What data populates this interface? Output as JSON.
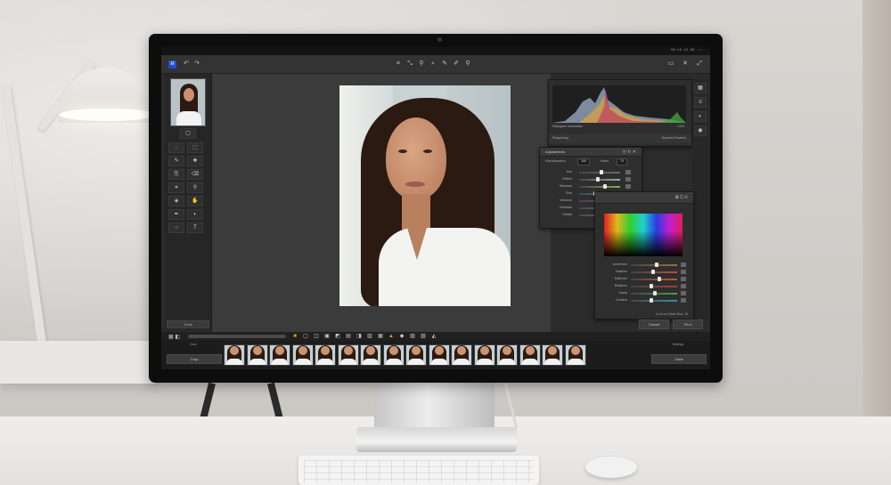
{
  "app": {
    "logo_text": "M",
    "menubar_status": "06:13  12 06  :::",
    "toolbar_icons": [
      "crop-icon",
      "transform-icon",
      "zoom-icon",
      "search-icon",
      "brush-icon",
      "eyedropper-icon",
      "loupe-icon"
    ],
    "toolbar_right_icons": [
      "compare-icon",
      "tools-icon",
      "expand-icon"
    ]
  },
  "left_panel": {
    "tools": [
      "lasso-icon",
      "marquee-icon",
      "brush-icon",
      "heal-icon",
      "clone-icon",
      "eraser-icon",
      "crop-icon",
      "zoom-icon",
      "paint-icon",
      "hand-icon",
      "pen-icon",
      "adjust-icon",
      "dodge-icon",
      "text-icon"
    ],
    "bottom_button": "Tools"
  },
  "histogram_panel": {
    "caption": "Histogram information",
    "footer_left": "Sharpening",
    "footer_right": "Brushes  Reselect",
    "value": "< 625"
  },
  "adjust_panel": {
    "title": "Adjustments",
    "field_label": "Hue/saturation",
    "field_value": "100",
    "field2_label": "Notes",
    "field2_value": "70",
    "rows": [
      {
        "label": "Hue",
        "level": 0.55,
        "color": "#6a6a6a"
      },
      {
        "label": "Whites",
        "level": 0.45,
        "color": "#a8a8a8"
      },
      {
        "label": "Shadows",
        "level": 0.62,
        "color": "#7fb04f"
      },
      {
        "label": "Tints",
        "level": 0.4,
        "color": "#46a0a0"
      },
      {
        "label": "Vibrance",
        "level": 0.58,
        "color": "#9a4fc0"
      },
      {
        "label": "Shadows",
        "level": 0.52,
        "color": "#4f7fd0"
      },
      {
        "label": "Details",
        "level": 0.42,
        "color": "#8a8a8a"
      }
    ]
  },
  "color_panel": {
    "rows": [
      {
        "label": "Undertone",
        "level": 0.55,
        "color": "#9a6f3d"
      },
      {
        "label": "Balance",
        "level": 0.48,
        "color": "#c04848"
      },
      {
        "label": "Midtones",
        "level": 0.62,
        "color": "#c05a30"
      },
      {
        "label": "Brilliance",
        "level": 0.45,
        "color": "#b03a3a"
      },
      {
        "label": "Clarity",
        "level": 0.52,
        "color": "#4aa04a"
      },
      {
        "label": "Shadow",
        "level": 0.44,
        "color": "#3a8fa0"
      }
    ],
    "footer": "Le ts el Colore  Duo: 10",
    "cancel_label": "Cancel",
    "ok_label": "Fix it"
  },
  "filmstrip": {
    "left_label": "Crop",
    "left_top_label": "Auto",
    "right_label": "Clear",
    "right_top_label": "Settings",
    "count": 16
  }
}
